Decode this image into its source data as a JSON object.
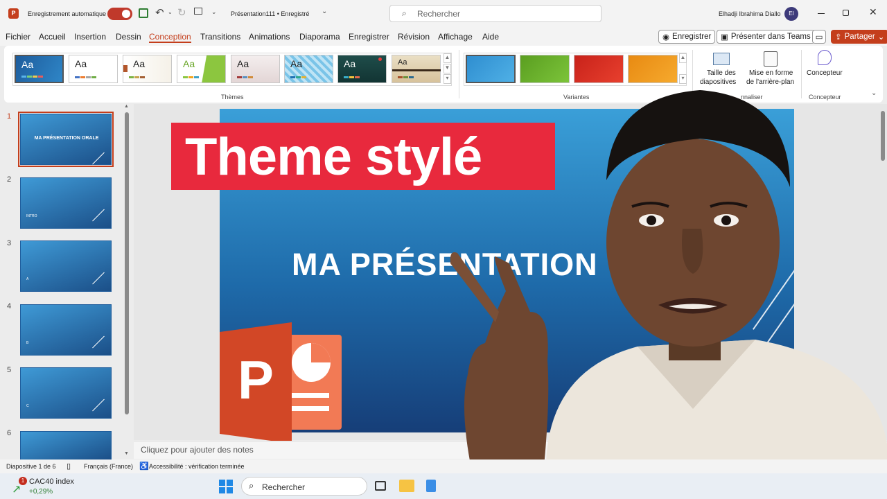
{
  "titlebar": {
    "autosave_label": "Enregistrement automatique",
    "doc_title": "Présentation111 • Enregistré",
    "search_placeholder": "Rechercher",
    "user_name": "Elhadji Ibrahima Diallo",
    "user_initials": "EI"
  },
  "menu": {
    "tabs": [
      "Fichier",
      "Accueil",
      "Insertion",
      "Dessin",
      "Conception",
      "Transitions",
      "Animations",
      "Diaporama",
      "Enregistrer",
      "Révision",
      "Affichage",
      "Aide"
    ],
    "active": "Conception",
    "record_btn": "Enregistrer",
    "teams_btn": "Présenter dans Teams",
    "share_btn": "Partager"
  },
  "ribbon": {
    "themes_label": "Thèmes",
    "variants_label": "Variantes",
    "customize_label": "nnaliser",
    "designer_group_label": "Concepteur",
    "theme_sample": "Aa",
    "slide_size_l1": "Taille des",
    "slide_size_l2": "diapositives",
    "bg_format_l1": "Mise en forme",
    "bg_format_l2": "de l'arrière-plan",
    "designer_btn": "Concepteur"
  },
  "slides": [
    {
      "num": "1",
      "text": "MA PRÉSENTATION ORALE"
    },
    {
      "num": "2",
      "text": "INTRO"
    },
    {
      "num": "3",
      "text": "A"
    },
    {
      "num": "4",
      "text": "B"
    },
    {
      "num": "5",
      "text": "C"
    },
    {
      "num": "6",
      "text": ""
    }
  ],
  "slide": {
    "title": "MA PRÉSENTATION"
  },
  "notes_placeholder": "Cliquez pour ajouter des notes",
  "banner_text": "Theme stylé",
  "status": {
    "slide_info": "Diapositive 1 de 6",
    "language": "Français (France)",
    "accessibility": "Accessibilité : vérification terminée"
  },
  "taskbar": {
    "stock_name": "CAC40 index",
    "stock_change": "+0,29%",
    "badge": "1",
    "search_label": "Rechercher"
  },
  "colors": {
    "accent": "#c43e1c",
    "banner": "#e8293d",
    "slide_blue": "#1e6aa9"
  }
}
